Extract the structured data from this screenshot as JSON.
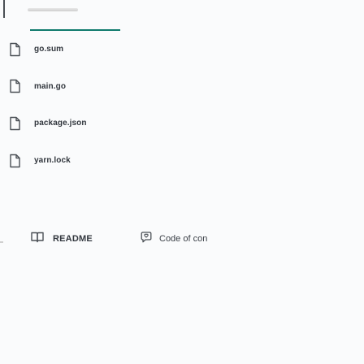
{
  "file_list": {
    "items": [
      {
        "name": "go.sum",
        "icon": "file-icon"
      },
      {
        "name": "main.go",
        "icon": "file-icon"
      },
      {
        "name": "package.json",
        "icon": "file-icon"
      },
      {
        "name": "yarn.lock",
        "icon": "file-icon"
      }
    ]
  },
  "readme_tabs": {
    "readme": {
      "label": "README",
      "icon": "book-icon"
    },
    "conduct": {
      "label": "Code of con",
      "icon": "conduct-icon"
    }
  },
  "colors": {
    "accent": "#0f7a6c",
    "text": "#31363d",
    "icon": "#4a4f55"
  }
}
